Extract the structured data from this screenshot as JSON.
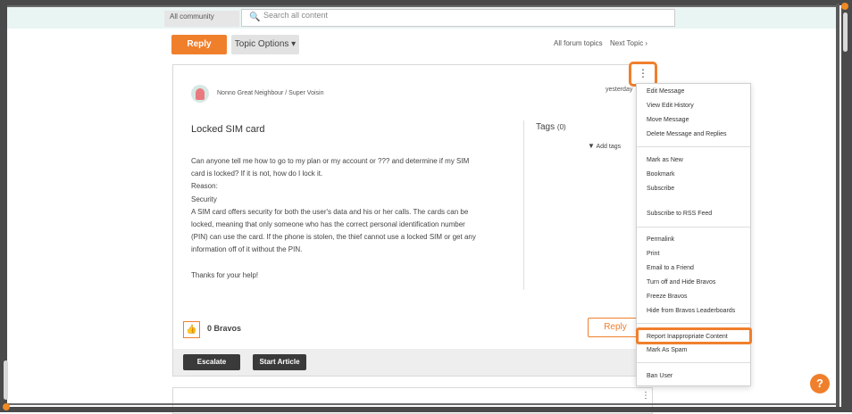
{
  "header": {
    "community_select": "All community",
    "search_placeholder": "Search all content"
  },
  "toolbar": {
    "reply_label": "Reply",
    "topic_options_label": "Topic Options ▾",
    "all_forum_topics": "All forum topics",
    "next_topic": "Next Topic  ›"
  },
  "post": {
    "author": "Nonno  Great Neighbour / Super Voisin",
    "timestamp": "yesterday",
    "title": "Locked SIM card",
    "body": [
      "Can anyone tell me how to go to my plan or my account or ???  and determine if my SIM",
      "card is locked?  If it is not, how do I lock it.",
      "Reason:",
      "Security",
      "A SIM card offers security for both the user's data and his or her calls. The cards can be",
      "locked, meaning that only someone who has the correct personal identification number",
      "(PIN) can use the card. If the phone is stolen, the thief cannot use a locked SIM or get any",
      "information off of it without the PIN.",
      "",
      "Thanks for your help!"
    ],
    "tags_label": "Tags",
    "tags_count": "(0)",
    "add_tags": "Add tags",
    "bravos": "0 Bravos",
    "reply_label": "Reply",
    "escalate_label": "Escalate",
    "start_article_label": "Start Article"
  },
  "menu": {
    "kebab": "⋮",
    "items": [
      "Edit Message",
      "View Edit History",
      "Move Message",
      "Delete Message and Replies",
      "Mark as New",
      "Bookmark",
      "Subscribe",
      "Subscribe to RSS Feed",
      "Permalink",
      "Print",
      "Email to a Friend",
      "Turn off and Hide Bravos",
      "Freeze Bravos",
      "Hide from Bravos Leaderboards",
      "Report Inappropriate Content",
      "Mark As Spam",
      "Ban User"
    ]
  },
  "help_icon": "?",
  "colors": {
    "accent": "#f07f2c",
    "dark_button": "#3a3a3a",
    "top_strip": "#e9f5f3"
  }
}
